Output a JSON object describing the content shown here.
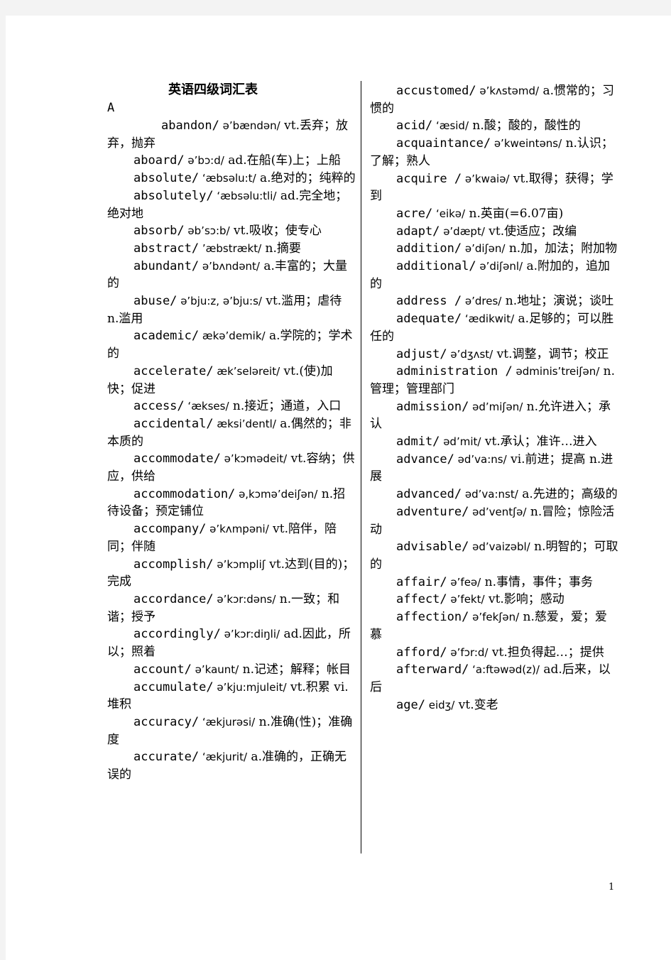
{
  "document": {
    "title": "英语四级词汇表",
    "section_letter": "A",
    "page_number": "1",
    "left_column": [
      {
        "word": "abandon/",
        "ipa": " ə’bændən/",
        "def": " vt.丢弃；放弃，抛弃"
      },
      {
        "word": "aboard/",
        "ipa": " ə’bɔ:d/",
        "def": " ad.在船(车)上；上船"
      },
      {
        "word": "absolute/",
        "ipa": " ‘æbsəlu:t/",
        "def": " a.绝对的；纯粹的"
      },
      {
        "word": "absolutely/",
        "ipa": " ‘æbsəlu:tli/",
        "def": " ad.完全地；绝对地"
      },
      {
        "word": "absorb/",
        "ipa": " əb’sɔ:b/",
        "def": " vt.吸收；使专心"
      },
      {
        "word": "abstract/",
        "ipa": " ’æbstrækt/",
        "def": " n.摘要"
      },
      {
        "word": "abundant/",
        "ipa": " ə’bʌndənt/",
        "def": " a.丰富的；大量的"
      },
      {
        "word": "abuse/",
        "ipa": " ə’bju:z, ə’bju:s/",
        "def": " vt.滥用；虐待 n.滥用"
      },
      {
        "word": "academic/",
        "ipa": " ækə’demik/",
        "def": " a.学院的；学术的"
      },
      {
        "word": "accelerate/",
        "ipa": " æk’seləreit/",
        "def": " vt.(使)加快；促进"
      },
      {
        "word": "access/",
        "ipa": " ‘ækses/",
        "def": " n.接近；通道，入口"
      },
      {
        "word": "accidental/",
        "ipa": " æksi’dentl/",
        "def": " a.偶然的；非本质的"
      },
      {
        "word": "accommodate/",
        "ipa": " ə’kɔmədeit/",
        "def": " vt.容纳；供应，供给"
      },
      {
        "word": "accommodation/",
        "ipa": " ə,kɔmə’deiʃən/",
        "def": " n.招待设备；预定铺位"
      },
      {
        "word": "accompany/",
        "ipa": " ə’kʌmpəni/",
        "def": " vt.陪伴，陪同；伴随"
      },
      {
        "word": "accomplish/",
        "ipa": " ə’kɔmpliʃ",
        "def": " vt.达到(目的)；完成"
      },
      {
        "word": "accordance/",
        "ipa": " ə’kɔr:dəns/",
        "def": " n.一致；和谐；授予"
      },
      {
        "word": "accordingly/",
        "ipa": " ə’kɔr:diŋli/",
        "def": " ad.因此，所以；照着"
      },
      {
        "word": "account/",
        "ipa": " ə’kaunt/",
        "def": " n.记述；解释；帐目"
      },
      {
        "word": "accumulate/",
        "ipa": " ə’kju:mjuleit/",
        "def": " vt.积累 vi.堆积"
      },
      {
        "word": "accuracy/",
        "ipa": " ‘ækjurəsi/",
        "def": " n.准确(性)；准确度"
      },
      {
        "word": "accurate/",
        "ipa": " ‘ækjurit/",
        "def": " a.准确的，正确无误的"
      }
    ],
    "right_column": [
      {
        "word": "accustomed/",
        "ipa": " ə’kʌstəmd/",
        "def": " a.惯常的；习惯的"
      },
      {
        "word": "acid/",
        "ipa": " ‘æsid/",
        "def": " n.酸；酸的，酸性的"
      },
      {
        "word": "acquaintance/",
        "ipa": " ə’kweintəns/",
        "def": " n.认识；了解；熟人"
      },
      {
        "word": "acquire /",
        "ipa": " ə’kwaiə/",
        "def": " vt.取得；获得；学到"
      },
      {
        "word": "acre/",
        "ipa": " ‘eikə/",
        "def": " n.英亩(=6.07亩)"
      },
      {
        "word": "adapt/",
        "ipa": " ə’dæpt/",
        "def": " vt.使适应；改编"
      },
      {
        "word": "addition/",
        "ipa": " ə’diʃən/",
        "def": " n.加，加法；附加物"
      },
      {
        "word": "additional/",
        "ipa": " ə’diʃənl/",
        "def": " a.附加的，追加的"
      },
      {
        "word": "address /",
        "ipa": " ə’dres/",
        "def": " n.地址；演说；谈吐"
      },
      {
        "word": "adequate/",
        "ipa": " ‘ædikwit/",
        "def": " a.足够的；可以胜任的"
      },
      {
        "word": "adjust/",
        "ipa": " ə’dʒʌst/",
        "def": " vt.调整，调节；校正"
      },
      {
        "word": "administration /",
        "ipa": " ədminis’treiʃən/",
        "def": " n.管理；管理部门"
      },
      {
        "word": "admission/",
        "ipa": " əd’miʃən/",
        "def": " n.允许进入；承认"
      },
      {
        "word": "admit/",
        "ipa": " əd’mit/",
        "def": " vt.承认；准许…进入"
      },
      {
        "word": "advance/",
        "ipa": " əd’va:ns/",
        "def": " vi.前进；提高 n.进展"
      },
      {
        "word": "advanced/",
        "ipa": " əd’va:nst/",
        "def": " a.先进的；高级的"
      },
      {
        "word": "adventure/",
        "ipa": " əd’ventʃə/",
        "def": " n.冒险；惊险活动"
      },
      {
        "word": "advisable/",
        "ipa": " əd’vaizəbl/",
        "def": " n.明智的；可取的"
      },
      {
        "word": "affair/",
        "ipa": " ə’feə/",
        "def": " n.事情，事件；事务"
      },
      {
        "word": "affect/",
        "ipa": " ə’fekt/",
        "def": " vt.影响；感动"
      },
      {
        "word": "affection/",
        "ipa": " ə’fekʃən/",
        "def": " n.慈爱，爱；爱慕"
      },
      {
        "word": "afford/",
        "ipa": " ə’fɔr:d/",
        "def": " vt.担负得起…；提供"
      },
      {
        "word": "afterward/",
        "ipa": " ‘a:ftəwəd(z)/",
        "def": " ad.后来，以后"
      },
      {
        "word": "age/",
        "ipa": " eidʒ/",
        "def": " vt.变老"
      }
    ]
  }
}
